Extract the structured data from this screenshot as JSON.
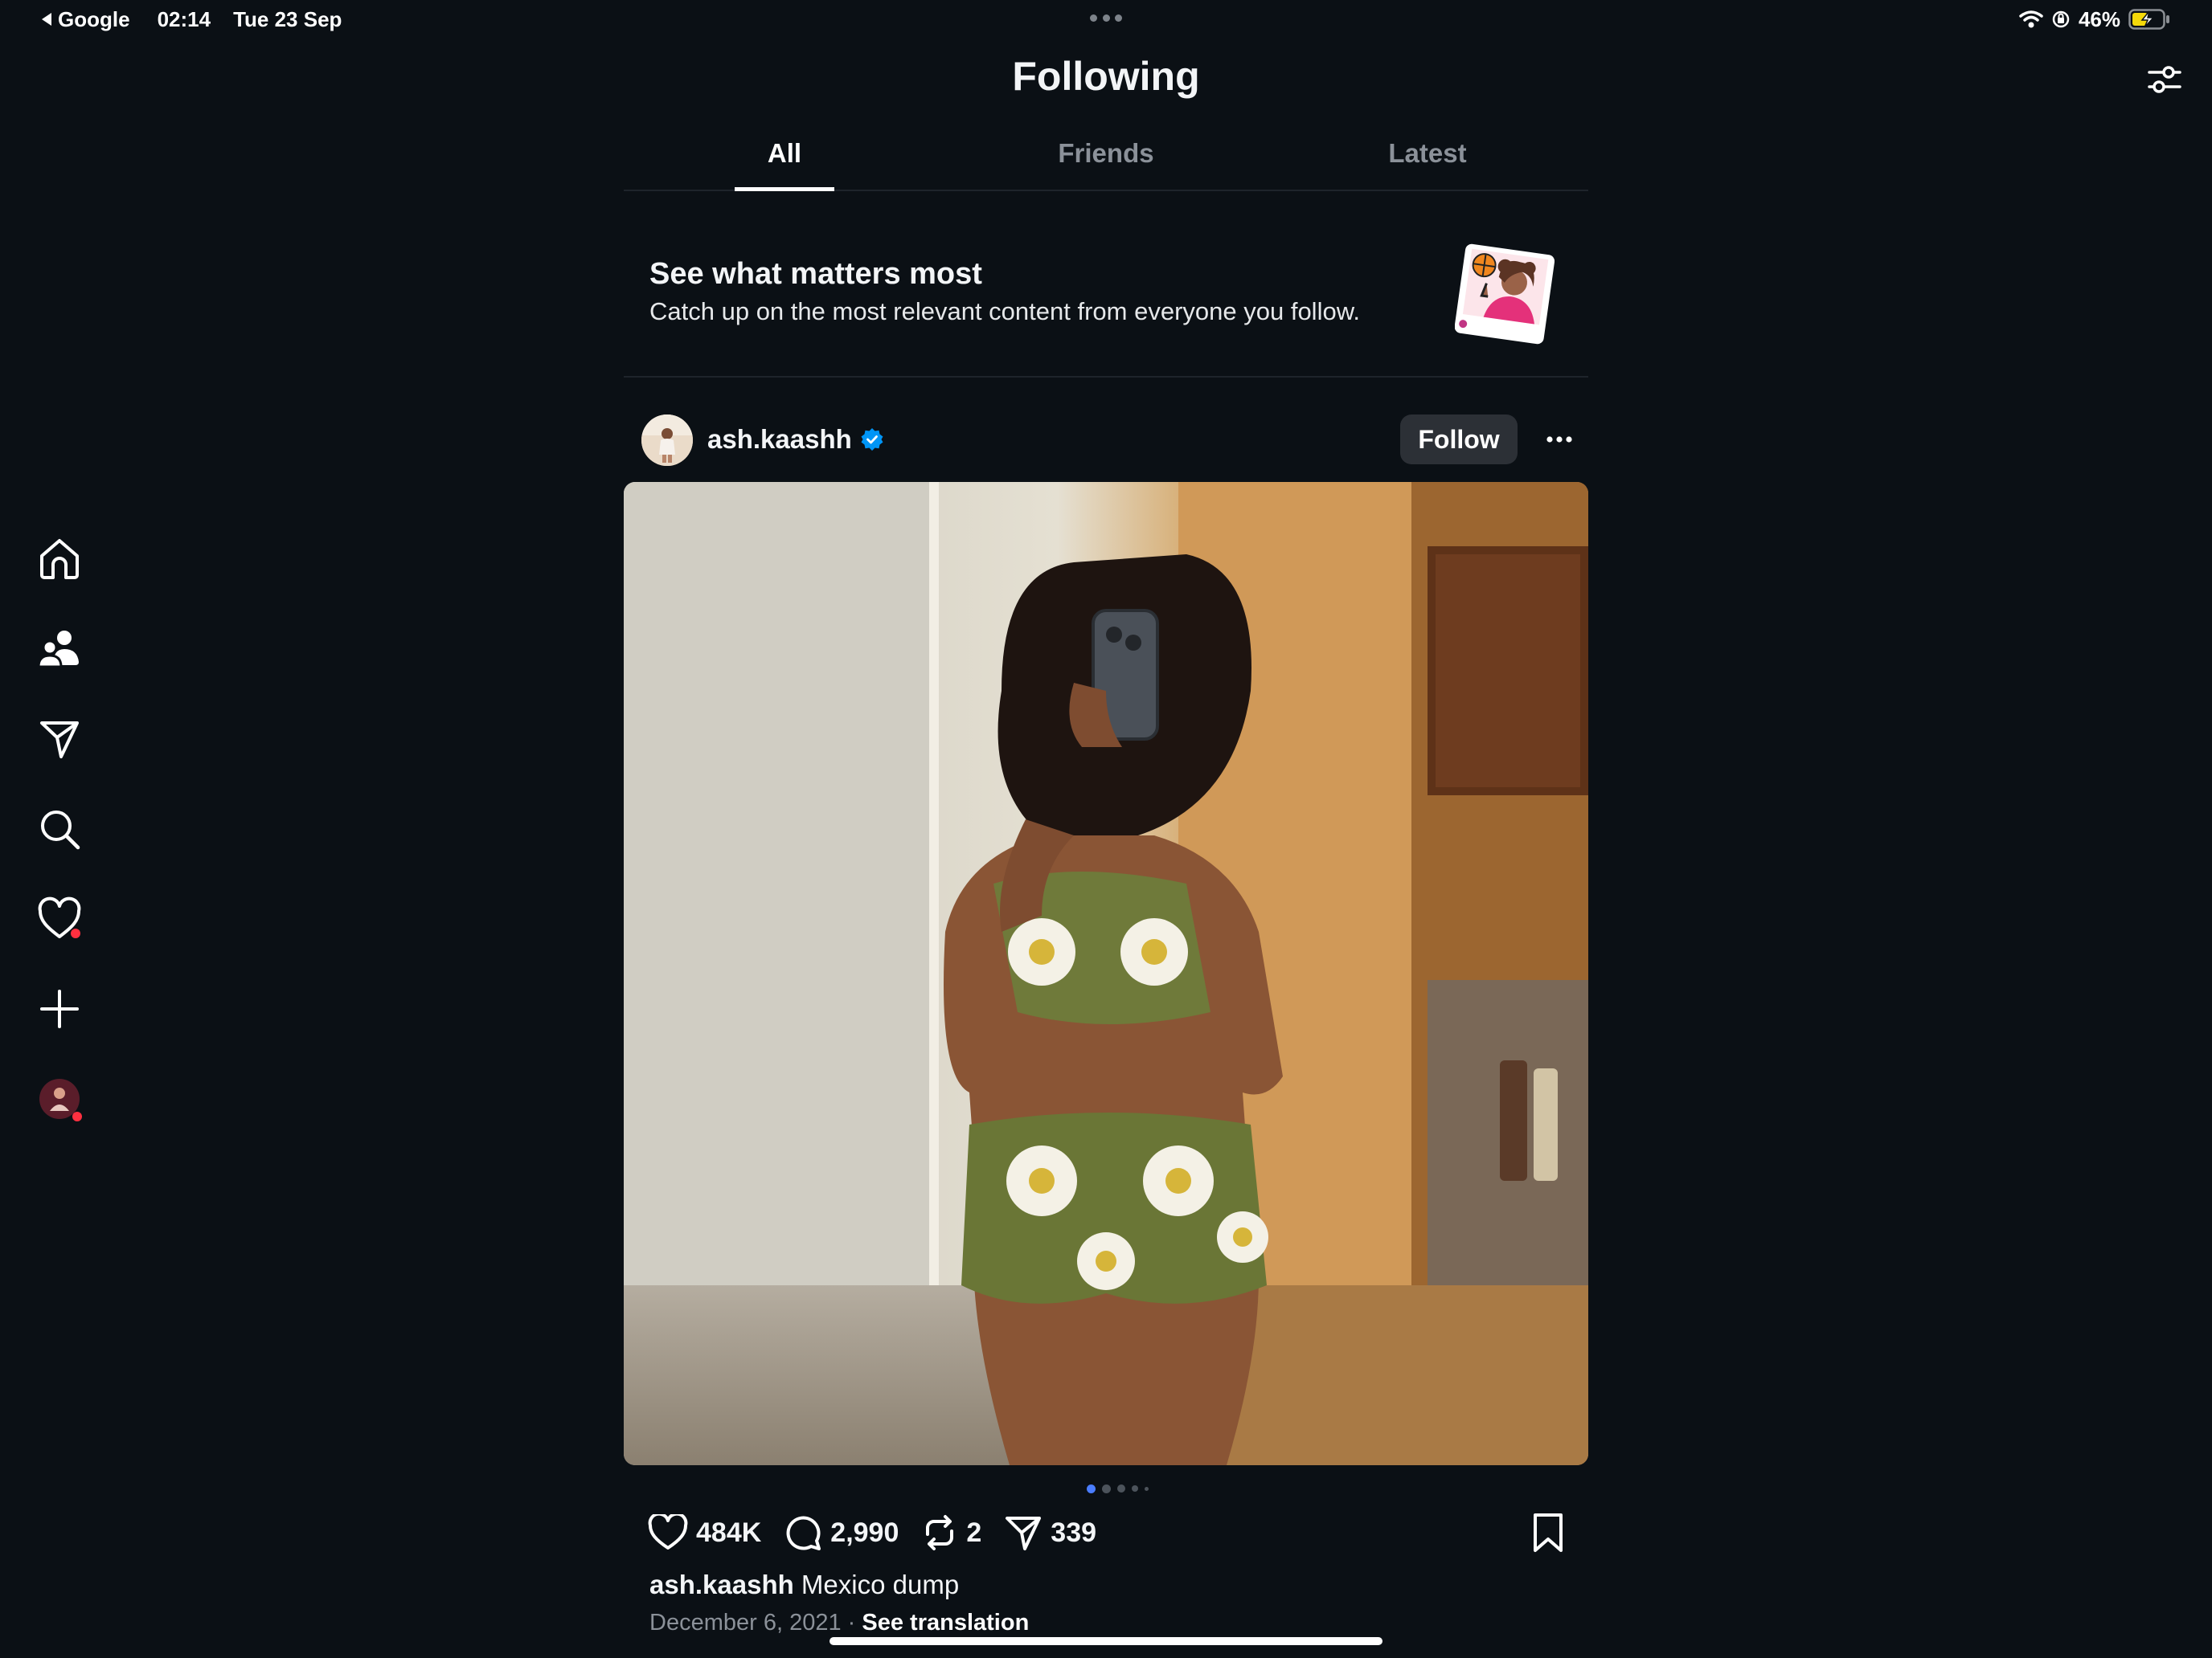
{
  "status_bar": {
    "back_app": "Google",
    "time": "02:14",
    "date": "Tue 23 Sep",
    "battery": "46%"
  },
  "header": {
    "title": "Following"
  },
  "tabs": [
    {
      "label": "All",
      "active": true
    },
    {
      "label": "Friends",
      "active": false
    },
    {
      "label": "Latest",
      "active": false
    }
  ],
  "banner": {
    "title": "See what matters most",
    "subtitle": "Catch up on the most relevant content from everyone you follow."
  },
  "sidebar": {
    "items": [
      {
        "icon": "home-icon"
      },
      {
        "icon": "people-icon"
      },
      {
        "icon": "send-icon"
      },
      {
        "icon": "search-icon"
      },
      {
        "icon": "heart-icon",
        "badge": true
      },
      {
        "icon": "plus-icon"
      },
      {
        "icon": "profile-avatar",
        "badge": true
      }
    ]
  },
  "post": {
    "username": "ash.kaashh",
    "verified": true,
    "follow_label": "Follow",
    "carousel_count": 5,
    "carousel_active": 0,
    "likes": "484K",
    "comments": "2,990",
    "reposts": "2",
    "shares": "339",
    "caption_user": "ash.kaashh",
    "caption_text": " Mexico dump",
    "date": "December 6, 2021",
    "separator": "·",
    "translate_label": "See translation"
  },
  "colors": {
    "background": "#0b1015",
    "text": "#f3f5f7",
    "muted": "#8b9199",
    "verified": "#0095f6",
    "notification": "#ff3040",
    "follow_button": "#2c3036"
  }
}
